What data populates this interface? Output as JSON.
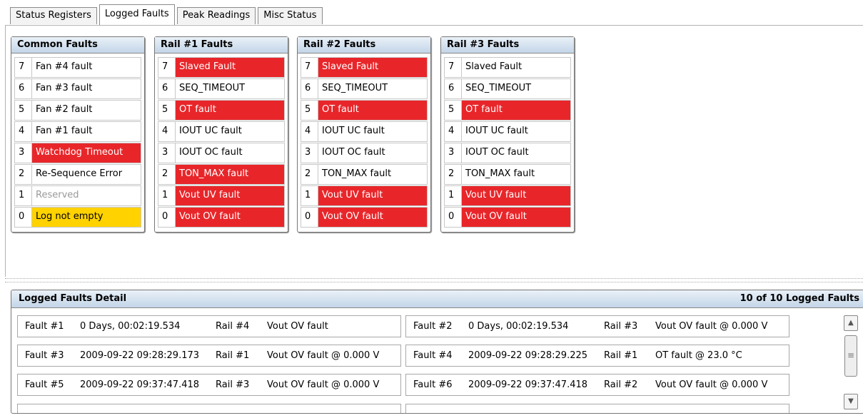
{
  "tabs": [
    "Status Registers",
    "Logged Faults",
    "Peak Readings",
    "Misc Status"
  ],
  "groups": [
    {
      "title": "Common Faults",
      "rows": [
        {
          "bit": "7",
          "label": "Fan #4 fault",
          "state": "normal"
        },
        {
          "bit": "6",
          "label": "Fan #3 fault",
          "state": "normal"
        },
        {
          "bit": "5",
          "label": "Fan #2 fault",
          "state": "normal"
        },
        {
          "bit": "4",
          "label": "Fan #1 fault",
          "state": "normal"
        },
        {
          "bit": "3",
          "label": "Watchdog Timeout",
          "state": "fault"
        },
        {
          "bit": "2",
          "label": "Re-Sequence Error",
          "state": "normal"
        },
        {
          "bit": "1",
          "label": "Reserved",
          "state": "reserved"
        },
        {
          "bit": "0",
          "label": "Log not empty",
          "state": "warning"
        }
      ]
    },
    {
      "title": "Rail #1 Faults",
      "rows": [
        {
          "bit": "7",
          "label": "Slaved Fault",
          "state": "fault"
        },
        {
          "bit": "6",
          "label": "SEQ_TIMEOUT",
          "state": "normal"
        },
        {
          "bit": "5",
          "label": "OT fault",
          "state": "fault"
        },
        {
          "bit": "4",
          "label": "IOUT UC fault",
          "state": "normal"
        },
        {
          "bit": "3",
          "label": "IOUT OC fault",
          "state": "normal"
        },
        {
          "bit": "2",
          "label": "TON_MAX fault",
          "state": "fault"
        },
        {
          "bit": "1",
          "label": "Vout UV fault",
          "state": "fault"
        },
        {
          "bit": "0",
          "label": "Vout OV fault",
          "state": "fault"
        }
      ]
    },
    {
      "title": "Rail #2 Faults",
      "rows": [
        {
          "bit": "7",
          "label": "Slaved Fault",
          "state": "fault"
        },
        {
          "bit": "6",
          "label": "SEQ_TIMEOUT",
          "state": "normal"
        },
        {
          "bit": "5",
          "label": "OT fault",
          "state": "fault"
        },
        {
          "bit": "4",
          "label": "IOUT UC fault",
          "state": "normal"
        },
        {
          "bit": "3",
          "label": "IOUT OC fault",
          "state": "normal"
        },
        {
          "bit": "2",
          "label": "TON_MAX fault",
          "state": "normal"
        },
        {
          "bit": "1",
          "label": "Vout UV fault",
          "state": "fault"
        },
        {
          "bit": "0",
          "label": "Vout OV fault",
          "state": "fault"
        }
      ]
    },
    {
      "title": "Rail #3 Faults",
      "rows": [
        {
          "bit": "7",
          "label": "Slaved Fault",
          "state": "normal"
        },
        {
          "bit": "6",
          "label": "SEQ_TIMEOUT",
          "state": "normal"
        },
        {
          "bit": "5",
          "label": "OT fault",
          "state": "fault"
        },
        {
          "bit": "4",
          "label": "IOUT UC fault",
          "state": "normal"
        },
        {
          "bit": "3",
          "label": "IOUT OC fault",
          "state": "normal"
        },
        {
          "bit": "2",
          "label": "TON_MAX fault",
          "state": "normal"
        },
        {
          "bit": "1",
          "label": "Vout UV fault",
          "state": "fault"
        },
        {
          "bit": "0",
          "label": "Vout OV fault",
          "state": "fault"
        }
      ]
    }
  ],
  "detail": {
    "title": "Logged Faults Detail",
    "count": "10 of 10 Logged Faults",
    "faults": [
      {
        "id": "Fault #1",
        "time": "0 Days, 00:02:19.534",
        "rail": "Rail #4",
        "desc": "Vout OV fault"
      },
      {
        "id": "Fault #2",
        "time": "0 Days, 00:02:19.534",
        "rail": "Rail #3",
        "desc": "Vout OV fault @ 0.000 V"
      },
      {
        "id": "Fault #3",
        "time": "2009-09-22 09:28:29.173",
        "rail": "Rail #1",
        "desc": "Vout OV fault @ 0.000 V"
      },
      {
        "id": "Fault #4",
        "time": "2009-09-22 09:28:29.225",
        "rail": "Rail #1",
        "desc": "OT fault @ 23.0 °C"
      },
      {
        "id": "Fault #5",
        "time": "2009-09-22 09:37:47.418",
        "rail": "Rail #3",
        "desc": "Vout OV fault @ 0.000 V"
      },
      {
        "id": "Fault #6",
        "time": "2009-09-22 09:37:47.418",
        "rail": "Rail #2",
        "desc": "Vout OV fault @ 0.000 V"
      }
    ]
  },
  "colors": {
    "fault": "#e8262a",
    "warning": "#ffd200",
    "reserved": "#999999"
  }
}
